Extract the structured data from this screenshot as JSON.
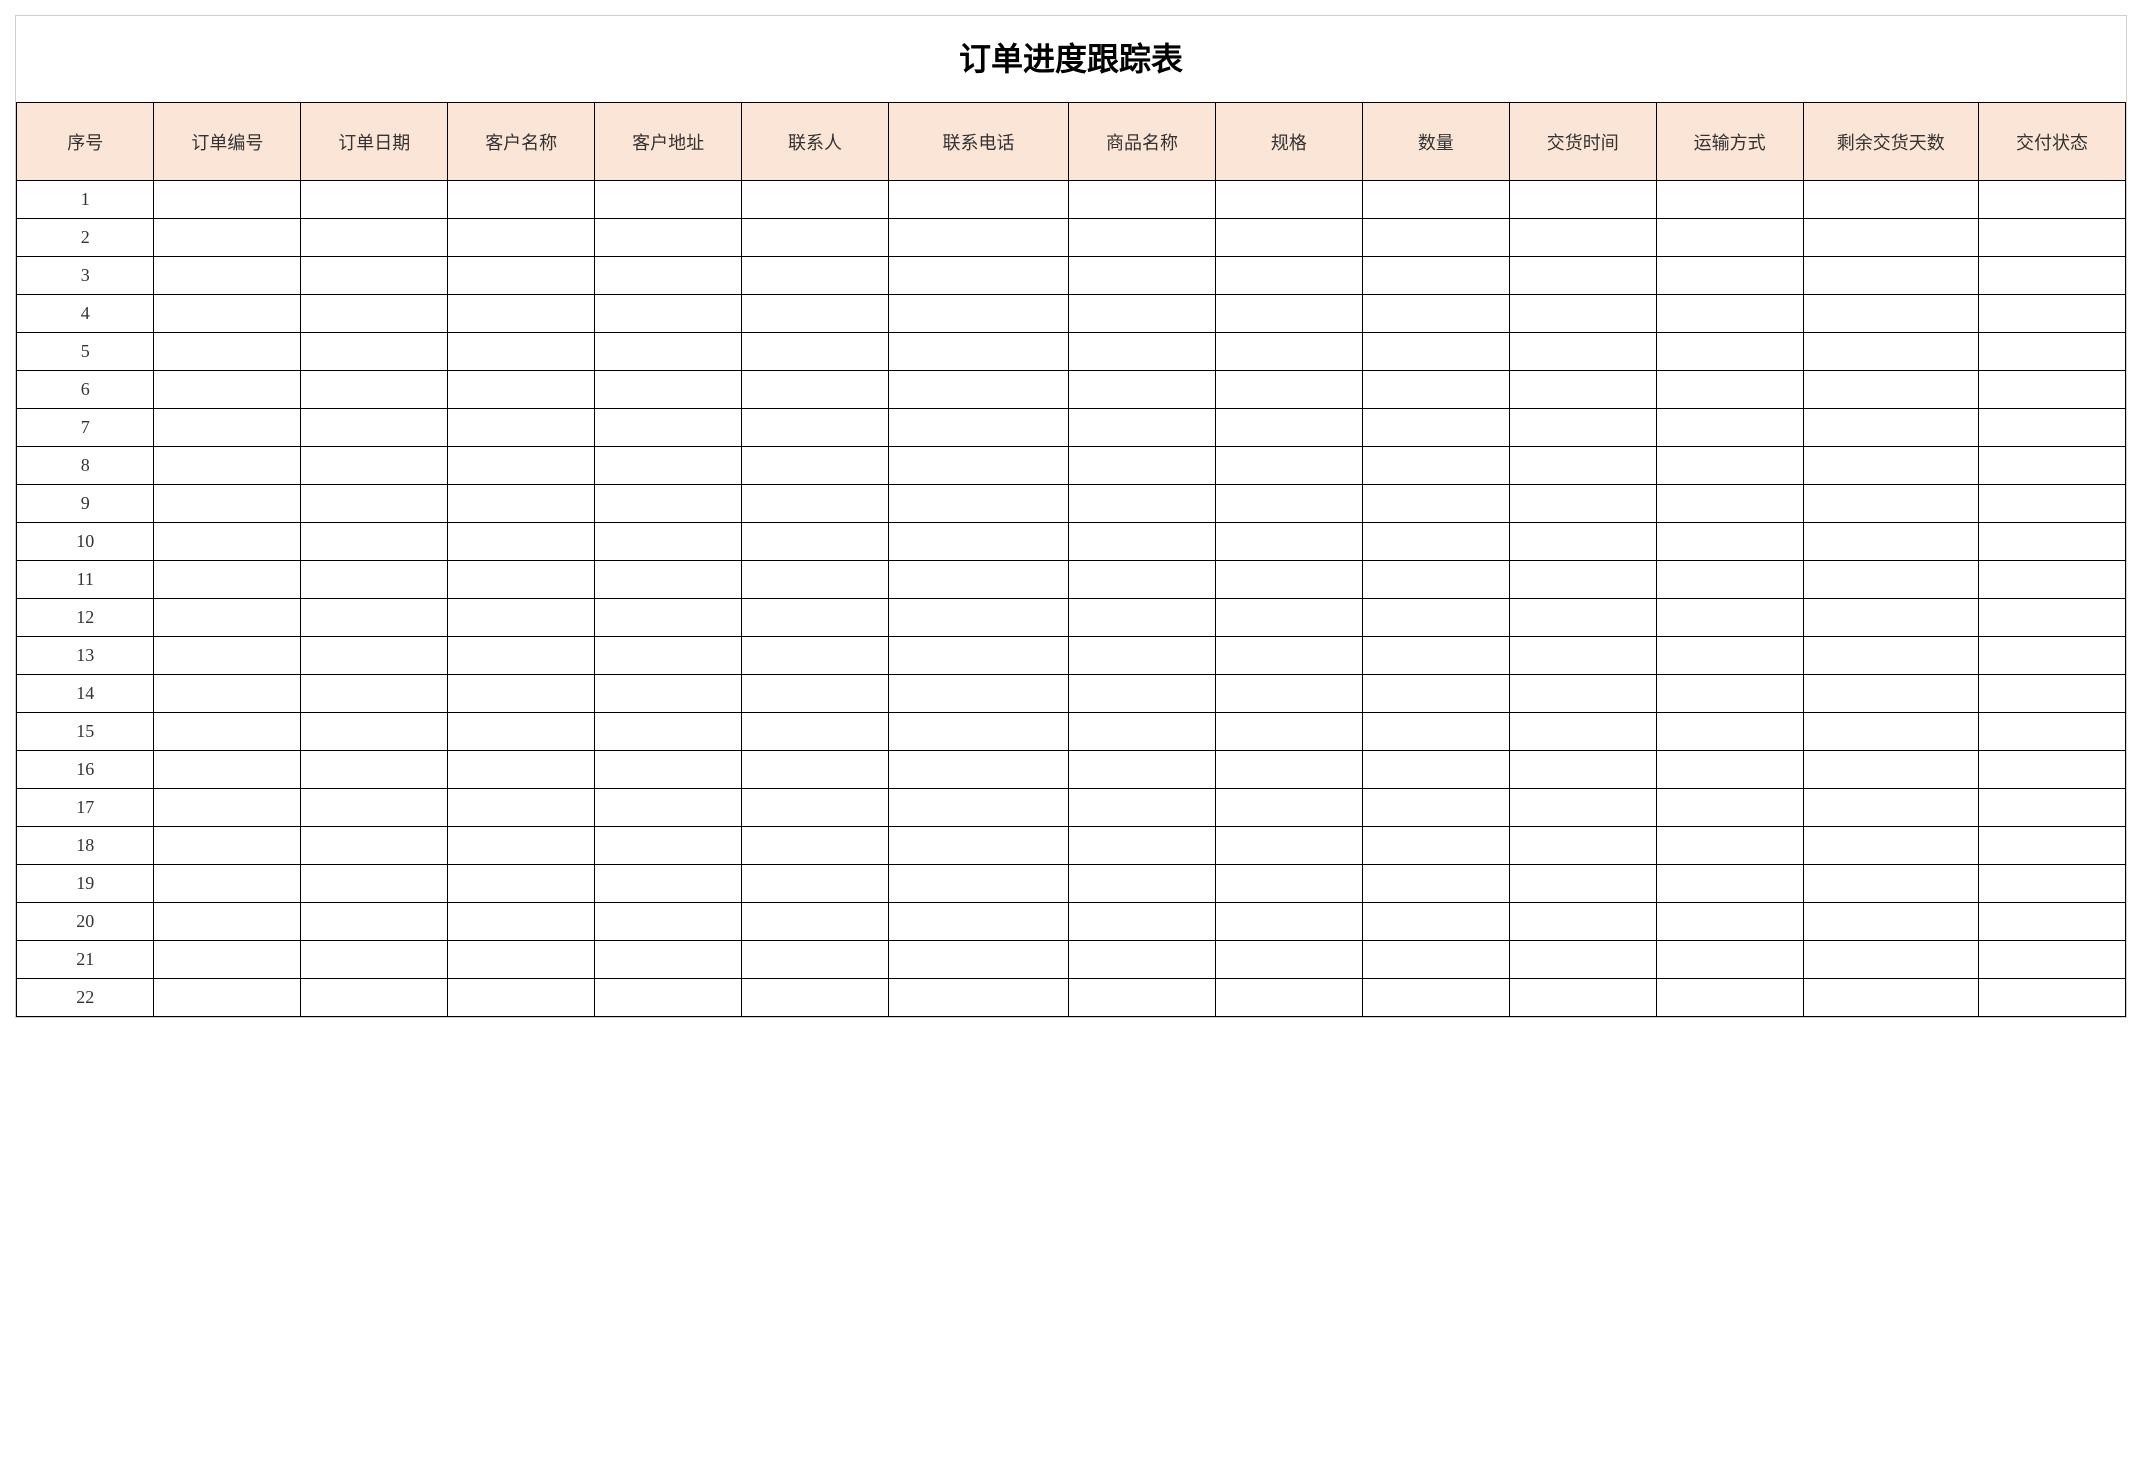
{
  "title": "订单进度跟踪表",
  "headers": [
    "序号",
    "订单编号",
    "订单日期",
    "客户名称",
    "客户地址",
    "联系人",
    "联系电话",
    "商品名称",
    "规格",
    "数量",
    "交货时间",
    "运输方式",
    "剩余交货天数",
    "交付状态"
  ],
  "rows": [
    {
      "seq": "1",
      "order_no": "",
      "order_date": "",
      "customer": "",
      "address": "",
      "contact": "",
      "phone": "",
      "product": "",
      "spec": "",
      "qty": "",
      "delivery_time": "",
      "ship_method": "",
      "days_left": "",
      "status": ""
    },
    {
      "seq": "2",
      "order_no": "",
      "order_date": "",
      "customer": "",
      "address": "",
      "contact": "",
      "phone": "",
      "product": "",
      "spec": "",
      "qty": "",
      "delivery_time": "",
      "ship_method": "",
      "days_left": "",
      "status": ""
    },
    {
      "seq": "3",
      "order_no": "",
      "order_date": "",
      "customer": "",
      "address": "",
      "contact": "",
      "phone": "",
      "product": "",
      "spec": "",
      "qty": "",
      "delivery_time": "",
      "ship_method": "",
      "days_left": "",
      "status": ""
    },
    {
      "seq": "4",
      "order_no": "",
      "order_date": "",
      "customer": "",
      "address": "",
      "contact": "",
      "phone": "",
      "product": "",
      "spec": "",
      "qty": "",
      "delivery_time": "",
      "ship_method": "",
      "days_left": "",
      "status": ""
    },
    {
      "seq": "5",
      "order_no": "",
      "order_date": "",
      "customer": "",
      "address": "",
      "contact": "",
      "phone": "",
      "product": "",
      "spec": "",
      "qty": "",
      "delivery_time": "",
      "ship_method": "",
      "days_left": "",
      "status": ""
    },
    {
      "seq": "6",
      "order_no": "",
      "order_date": "",
      "customer": "",
      "address": "",
      "contact": "",
      "phone": "",
      "product": "",
      "spec": "",
      "qty": "",
      "delivery_time": "",
      "ship_method": "",
      "days_left": "",
      "status": ""
    },
    {
      "seq": "7",
      "order_no": "",
      "order_date": "",
      "customer": "",
      "address": "",
      "contact": "",
      "phone": "",
      "product": "",
      "spec": "",
      "qty": "",
      "delivery_time": "",
      "ship_method": "",
      "days_left": "",
      "status": ""
    },
    {
      "seq": "8",
      "order_no": "",
      "order_date": "",
      "customer": "",
      "address": "",
      "contact": "",
      "phone": "",
      "product": "",
      "spec": "",
      "qty": "",
      "delivery_time": "",
      "ship_method": "",
      "days_left": "",
      "status": ""
    },
    {
      "seq": "9",
      "order_no": "",
      "order_date": "",
      "customer": "",
      "address": "",
      "contact": "",
      "phone": "",
      "product": "",
      "spec": "",
      "qty": "",
      "delivery_time": "",
      "ship_method": "",
      "days_left": "",
      "status": ""
    },
    {
      "seq": "10",
      "order_no": "",
      "order_date": "",
      "customer": "",
      "address": "",
      "contact": "",
      "phone": "",
      "product": "",
      "spec": "",
      "qty": "",
      "delivery_time": "",
      "ship_method": "",
      "days_left": "",
      "status": ""
    },
    {
      "seq": "11",
      "order_no": "",
      "order_date": "",
      "customer": "",
      "address": "",
      "contact": "",
      "phone": "",
      "product": "",
      "spec": "",
      "qty": "",
      "delivery_time": "",
      "ship_method": "",
      "days_left": "",
      "status": ""
    },
    {
      "seq": "12",
      "order_no": "",
      "order_date": "",
      "customer": "",
      "address": "",
      "contact": "",
      "phone": "",
      "product": "",
      "spec": "",
      "qty": "",
      "delivery_time": "",
      "ship_method": "",
      "days_left": "",
      "status": ""
    },
    {
      "seq": "13",
      "order_no": "",
      "order_date": "",
      "customer": "",
      "address": "",
      "contact": "",
      "phone": "",
      "product": "",
      "spec": "",
      "qty": "",
      "delivery_time": "",
      "ship_method": "",
      "days_left": "",
      "status": ""
    },
    {
      "seq": "14",
      "order_no": "",
      "order_date": "",
      "customer": "",
      "address": "",
      "contact": "",
      "phone": "",
      "product": "",
      "spec": "",
      "qty": "",
      "delivery_time": "",
      "ship_method": "",
      "days_left": "",
      "status": ""
    },
    {
      "seq": "15",
      "order_no": "",
      "order_date": "",
      "customer": "",
      "address": "",
      "contact": "",
      "phone": "",
      "product": "",
      "spec": "",
      "qty": "",
      "delivery_time": "",
      "ship_method": "",
      "days_left": "",
      "status": ""
    },
    {
      "seq": "16",
      "order_no": "",
      "order_date": "",
      "customer": "",
      "address": "",
      "contact": "",
      "phone": "",
      "product": "",
      "spec": "",
      "qty": "",
      "delivery_time": "",
      "ship_method": "",
      "days_left": "",
      "status": ""
    },
    {
      "seq": "17",
      "order_no": "",
      "order_date": "",
      "customer": "",
      "address": "",
      "contact": "",
      "phone": "",
      "product": "",
      "spec": "",
      "qty": "",
      "delivery_time": "",
      "ship_method": "",
      "days_left": "",
      "status": ""
    },
    {
      "seq": "18",
      "order_no": "",
      "order_date": "",
      "customer": "",
      "address": "",
      "contact": "",
      "phone": "",
      "product": "",
      "spec": "",
      "qty": "",
      "delivery_time": "",
      "ship_method": "",
      "days_left": "",
      "status": ""
    },
    {
      "seq": "19",
      "order_no": "",
      "order_date": "",
      "customer": "",
      "address": "",
      "contact": "",
      "phone": "",
      "product": "",
      "spec": "",
      "qty": "",
      "delivery_time": "",
      "ship_method": "",
      "days_left": "",
      "status": ""
    },
    {
      "seq": "20",
      "order_no": "",
      "order_date": "",
      "customer": "",
      "address": "",
      "contact": "",
      "phone": "",
      "product": "",
      "spec": "",
      "qty": "",
      "delivery_time": "",
      "ship_method": "",
      "days_left": "",
      "status": ""
    },
    {
      "seq": "21",
      "order_no": "",
      "order_date": "",
      "customer": "",
      "address": "",
      "contact": "",
      "phone": "",
      "product": "",
      "spec": "",
      "qty": "",
      "delivery_time": "",
      "ship_method": "",
      "days_left": "",
      "status": ""
    },
    {
      "seq": "22",
      "order_no": "",
      "order_date": "",
      "customer": "",
      "address": "",
      "contact": "",
      "phone": "",
      "product": "",
      "spec": "",
      "qty": "",
      "delivery_time": "",
      "ship_method": "",
      "days_left": "",
      "status": ""
    }
  ]
}
